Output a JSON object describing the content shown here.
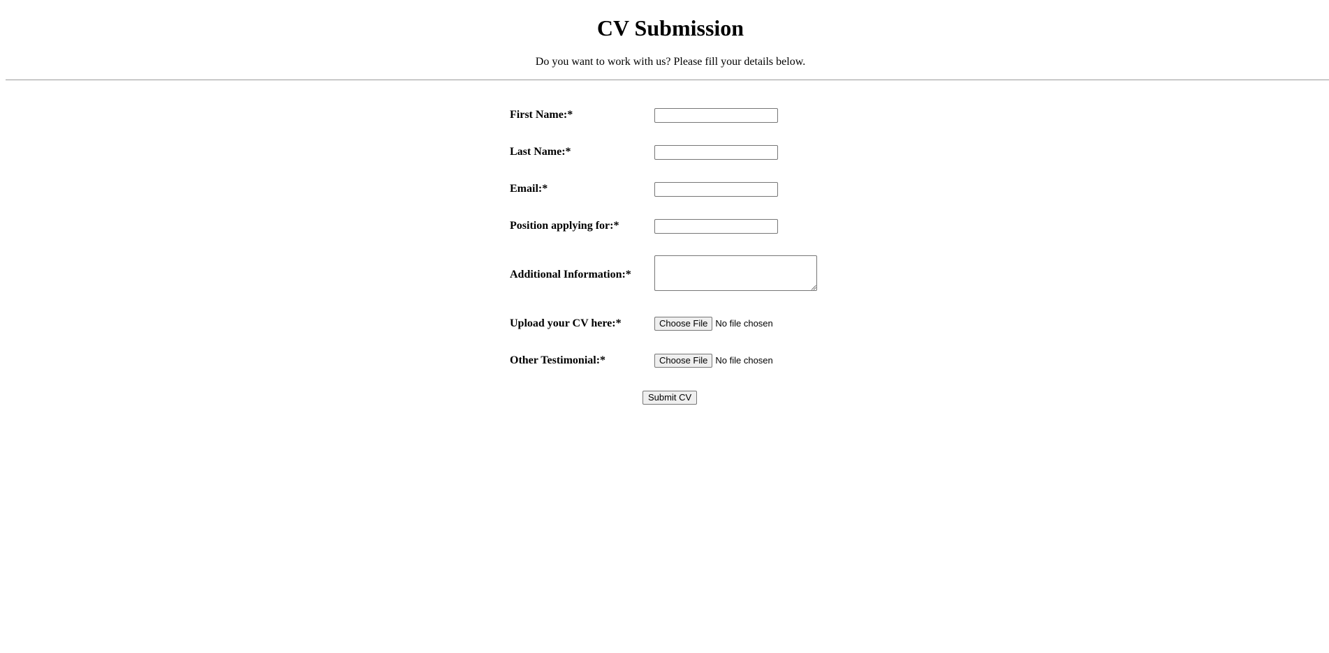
{
  "header": {
    "title": "CV Submission",
    "subtitle": "Do you want to work with us? Please fill your details below."
  },
  "form": {
    "fields": [
      {
        "label": "First Name:*",
        "value": ""
      },
      {
        "label": "Last Name:*",
        "value": ""
      },
      {
        "label": "Email:*",
        "value": ""
      },
      {
        "label": "Position applying for:*",
        "value": ""
      },
      {
        "label": "Additional Information:*",
        "value": ""
      }
    ],
    "uploads": [
      {
        "label": "Upload your CV here:*",
        "button_label": "Choose File",
        "status": "No file chosen"
      },
      {
        "label": "Other Testimonial:*",
        "button_label": "Choose File",
        "status": "No file chosen"
      }
    ],
    "submit_label": "Submit CV"
  },
  "colors": {
    "background": "#ffffff",
    "text": "#000000",
    "divider": "#9a9a9a",
    "input_border": "#767676",
    "button_background": "#efefef"
  },
  "icons": [
    "resize-grip-icon"
  ]
}
